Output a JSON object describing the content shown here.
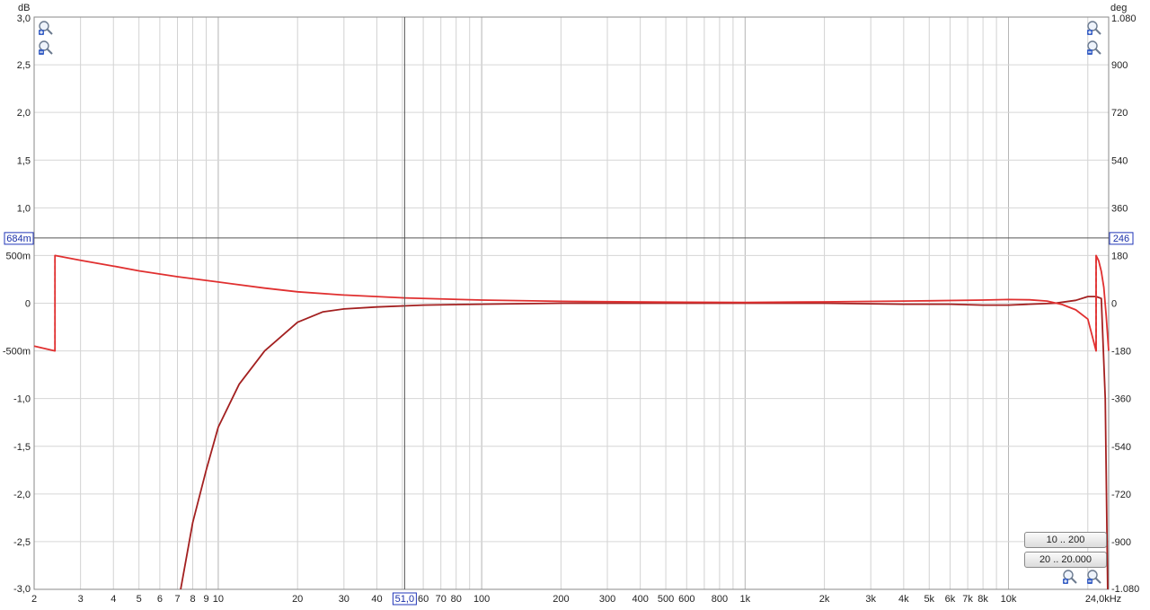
{
  "chart_data": {
    "type": "line",
    "x_scale": "log",
    "grid": true,
    "legend": "none",
    "xlim": [
      2,
      24000
    ],
    "ylim": [
      -3.0,
      3.0
    ],
    "ylim_right": [
      -1080,
      1080
    ],
    "xlabel": "",
    "ylabel": "dB",
    "ylabel_right": "deg",
    "x_ticks": [
      {
        "v": 2,
        "label": "2"
      },
      {
        "v": 3,
        "label": "3"
      },
      {
        "v": 4,
        "label": "4"
      },
      {
        "v": 5,
        "label": "5"
      },
      {
        "v": 6,
        "label": "6"
      },
      {
        "v": 7,
        "label": "7"
      },
      {
        "v": 8,
        "label": "8"
      },
      {
        "v": 9,
        "label": "9"
      },
      {
        "v": 10,
        "label": "10"
      },
      {
        "v": 20,
        "label": "20"
      },
      {
        "v": 30,
        "label": "30"
      },
      {
        "v": 40,
        "label": "40"
      },
      {
        "v": 60,
        "label": "60"
      },
      {
        "v": 70,
        "label": "70"
      },
      {
        "v": 80,
        "label": "80"
      },
      {
        "v": 100,
        "label": "100"
      },
      {
        "v": 200,
        "label": "200"
      },
      {
        "v": 300,
        "label": "300"
      },
      {
        "v": 400,
        "label": "400"
      },
      {
        "v": 500,
        "label": "500"
      },
      {
        "v": 600,
        "label": "600"
      },
      {
        "v": 800,
        "label": "800"
      },
      {
        "v": 1000,
        "label": "1k"
      },
      {
        "v": 2000,
        "label": "2k"
      },
      {
        "v": 3000,
        "label": "3k"
      },
      {
        "v": 4000,
        "label": "4k"
      },
      {
        "v": 5000,
        "label": "5k"
      },
      {
        "v": 6000,
        "label": "6k"
      },
      {
        "v": 7000,
        "label": "7k"
      },
      {
        "v": 8000,
        "label": "8k"
      },
      {
        "v": 10000,
        "label": "10k"
      },
      {
        "v": 24000,
        "label": "24,0kHz"
      }
    ],
    "y_ticks": [
      {
        "v": 3.0,
        "label": "3,0"
      },
      {
        "v": 2.5,
        "label": "2,5"
      },
      {
        "v": 2.0,
        "label": "2,0"
      },
      {
        "v": 1.5,
        "label": "1,5"
      },
      {
        "v": 1.0,
        "label": "1,0"
      },
      {
        "v": 0.5,
        "label": "500m"
      },
      {
        "v": 0,
        "label": "0"
      },
      {
        "v": -0.5,
        "label": "-500m"
      },
      {
        "v": -1.0,
        "label": "-1,0"
      },
      {
        "v": -1.5,
        "label": "-1,5"
      },
      {
        "v": -2.0,
        "label": "-2,0"
      },
      {
        "v": -2.5,
        "label": "-2,5"
      },
      {
        "v": -3.0,
        "label": "-3,0"
      }
    ],
    "y_ticks_right": [
      {
        "v": 1080,
        "label": "1.080"
      },
      {
        "v": 900,
        "label": "900"
      },
      {
        "v": 720,
        "label": "720"
      },
      {
        "v": 540,
        "label": "540"
      },
      {
        "v": 360,
        "label": "360"
      },
      {
        "v": 180,
        "label": "180"
      },
      {
        "v": 0,
        "label": "0"
      },
      {
        "v": -180,
        "label": "-180"
      },
      {
        "v": -360,
        "label": "-360"
      },
      {
        "v": -540,
        "label": "-540"
      },
      {
        "v": -720,
        "label": "-720"
      },
      {
        "v": -900,
        "label": "-900"
      },
      {
        "v": -1080,
        "label": "-1.080"
      }
    ],
    "cursor": {
      "x": 51.0,
      "x_label": "51,0",
      "y": 0.684,
      "y_label": "684m",
      "y_right_label": "246"
    },
    "series": [
      {
        "axis": "left",
        "color": "#a32020",
        "x": [
          7.2,
          8,
          9,
          10,
          12,
          15,
          20,
          25,
          30,
          40,
          60,
          100,
          200,
          500,
          1000,
          2000,
          4000,
          6000,
          8000,
          10000,
          12000,
          15000,
          18000,
          20000,
          21500,
          22500,
          23300,
          23800
        ],
        "y": [
          -3.0,
          -2.3,
          -1.75,
          -1.3,
          -0.85,
          -0.5,
          -0.2,
          -0.09,
          -0.06,
          -0.04,
          -0.02,
          -0.01,
          0.0,
          0.0,
          0.0,
          0.0,
          -0.01,
          -0.01,
          -0.02,
          -0.02,
          -0.01,
          0.0,
          0.03,
          0.07,
          0.07,
          0.05,
          -1.0,
          -3.0
        ]
      },
      {
        "axis": "right",
        "color": "#e03030",
        "x": [
          2,
          2.4,
          2.4,
          2.4,
          3,
          4,
          5,
          7,
          10,
          15,
          20,
          30,
          51,
          100,
          200,
          500,
          1000,
          2000,
          5000,
          8000,
          10000,
          12000,
          14000,
          16000,
          18000,
          20000,
          21500,
          21500,
          21500,
          22000,
          22500,
          23000,
          23500,
          24000
        ],
        "y": [
          -162,
          -180,
          -180,
          180,
          162,
          140,
          122,
          100,
          80,
          57,
          43,
          31,
          20,
          12,
          7,
          4,
          3,
          5,
          9,
          12,
          14,
          13,
          8,
          -5,
          -25,
          -60,
          -180,
          -180,
          180,
          160,
          120,
          60,
          -50,
          -180
        ]
      }
    ]
  },
  "buttons": {
    "range_10_200": "10 .. 200",
    "range_20_20000": "20 .. 20.000"
  },
  "icons": {
    "zoom_in": "zoom-in-icon",
    "zoom_out": "zoom-out-icon"
  }
}
